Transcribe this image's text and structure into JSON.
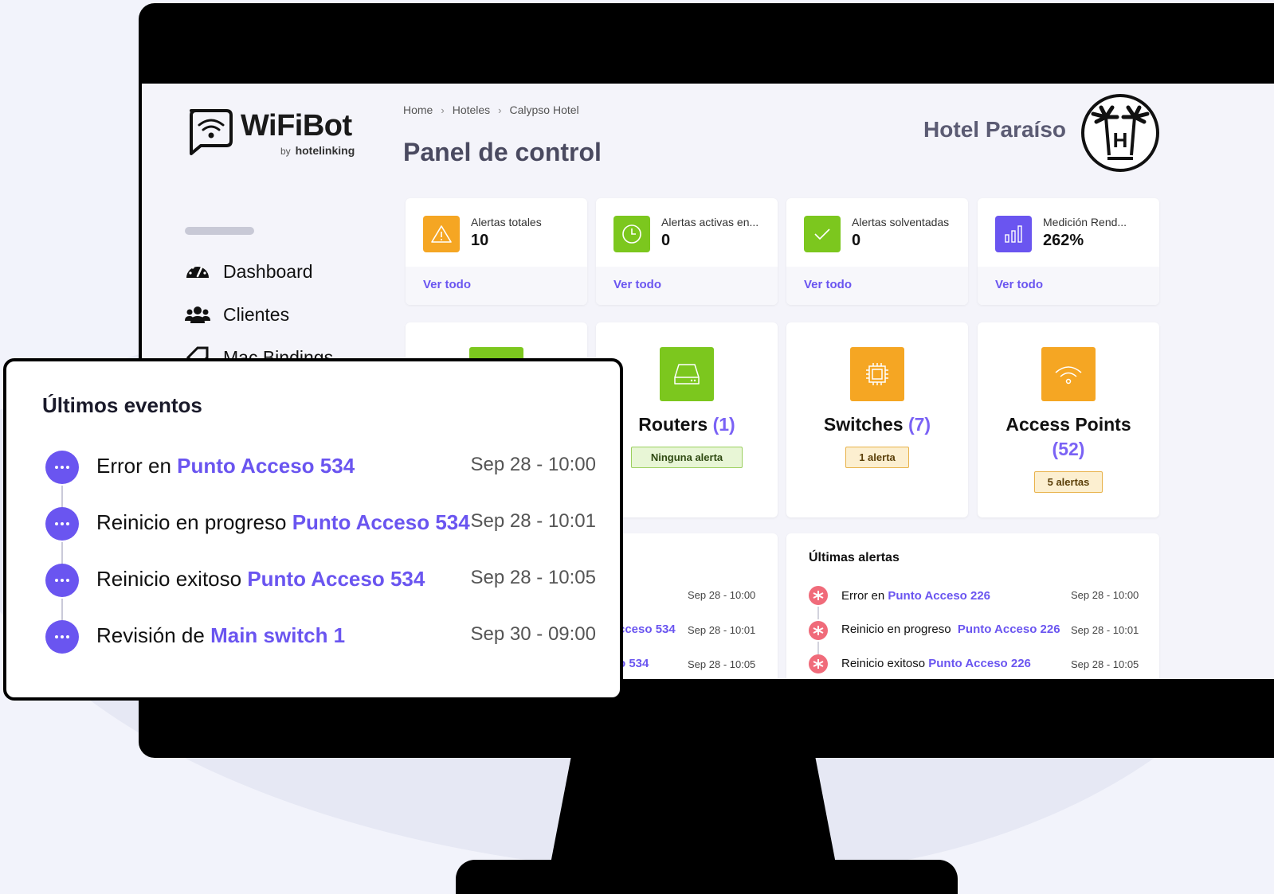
{
  "brand": {
    "name": "WiFiBot",
    "by": "by",
    "company": "hotelinking"
  },
  "sidebar": {
    "items": [
      {
        "label": "Dashboard",
        "icon": "dashboard-gauge-icon"
      },
      {
        "label": "Clientes",
        "icon": "users-icon"
      },
      {
        "label": "Mac Bindings",
        "icon": "tag-icon"
      }
    ]
  },
  "breadcrumb": [
    "Home",
    "Hoteles",
    "Calypso Hotel"
  ],
  "page_title": "Panel de control",
  "hotel": {
    "name": "Hotel Paraíso",
    "logo_letter": "H"
  },
  "stats": [
    {
      "label": "Alertas totales",
      "value": "10",
      "link": "Ver todo",
      "icon": "warning-triangle-icon",
      "color": "#f5a623"
    },
    {
      "label": "Alertas activas en...",
      "value": "0",
      "link": "Ver todo",
      "icon": "clock-icon",
      "color": "#7cc71e"
    },
    {
      "label": "Alertas solventadas",
      "value": "0",
      "link": "Ver todo",
      "icon": "check-icon",
      "color": "#7cc71e"
    },
    {
      "label": "Medición Rend...",
      "value": "262%",
      "link": "Ver todo",
      "icon": "bar-chart-icon",
      "color": "#6a55f0"
    }
  ],
  "devices": [
    {
      "title": "Routers",
      "count": "(1)",
      "badge": "Ninguna alerta",
      "icon": "router-icon",
      "color": "#7cc71e",
      "badge_type": "green"
    },
    {
      "title": "Switches",
      "count": "(7)",
      "badge": "1 alerta",
      "icon": "chip-icon",
      "color": "#f5a623",
      "badge_type": "amber"
    },
    {
      "title": "Access Points",
      "count": "(52)",
      "badge": "5 alertas",
      "icon": "wifi-icon",
      "color": "#f5a623",
      "badge_type": "amber"
    }
  ],
  "left_mini": {
    "rows": [
      {
        "link": "",
        "time": "Sep 28 - 10:00"
      },
      {
        "link": "cceso 534",
        "time": "Sep 28 - 10:01"
      },
      {
        "link": "o 534",
        "time": "Sep 28 - 10:05"
      }
    ]
  },
  "ultimas_alertas": {
    "title": "Últimas alertas",
    "rows": [
      {
        "text": "Error en",
        "link": "Punto Acceso 226",
        "time": "Sep 28 - 10:00"
      },
      {
        "text": "Reinicio en progreso",
        "link": "Punto Acceso 226",
        "time": "Sep 28 - 10:01"
      },
      {
        "text": "Reinicio exitoso",
        "link": "Punto Acceso 226",
        "time": "Sep 28 - 10:05"
      }
    ]
  },
  "events": {
    "title": "Últimos eventos",
    "items": [
      {
        "text": "Error en",
        "link": "Punto Acceso 534",
        "time": "Sep 28 - 10:00"
      },
      {
        "text": "Reinicio en progreso",
        "link": "Punto Acceso 534",
        "time": "Sep 28 - 10:01"
      },
      {
        "text": "Reinicio exitoso",
        "link": "Punto Acceso 534",
        "time": "Sep 28 - 10:05"
      },
      {
        "text": "Revisión de",
        "link": "Main switch 1",
        "time": "Sep 30 - 09:00"
      }
    ]
  },
  "colors": {
    "accent": "#6a55f0",
    "green": "#7cc71e",
    "amber": "#f5a623",
    "alert": "#f06b7a"
  }
}
